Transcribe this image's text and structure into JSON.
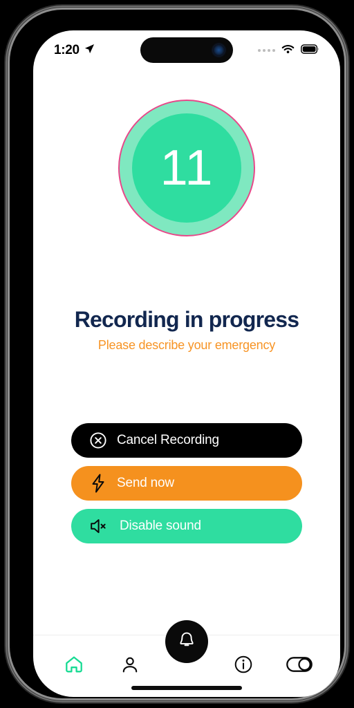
{
  "status_bar": {
    "time": "1:20",
    "location_icon": "location-arrow-icon",
    "signal_icon": "cellular-dots-icon",
    "wifi_icon": "wifi-icon",
    "battery_icon": "battery-full-icon"
  },
  "timer": {
    "count": "11",
    "ring_border_color": "#E8488A",
    "ring_fill_color": "#7FE8C0",
    "inner_fill_color": "#2FDDA0",
    "count_color": "#FFFFFF"
  },
  "headings": {
    "title": "Recording in progress",
    "title_color": "#12274F",
    "subtitle": "Please describe your emergency",
    "subtitle_color": "#F79425"
  },
  "actions": [
    {
      "label": "Cancel Recording",
      "icon": "circle-x-icon",
      "bg_color": "#000000",
      "text_color": "#FFFFFF"
    },
    {
      "label": "Send now",
      "icon": "lightning-bolt-icon",
      "bg_color": "#F5911E",
      "text_color": "#FFFFFF"
    },
    {
      "label": "Disable sound",
      "icon": "speaker-mute-icon",
      "bg_color": "#2FDDA0",
      "text_color": "#FFFFFF"
    }
  ],
  "bottom_nav": {
    "items": [
      {
        "name": "home",
        "icon": "home-icon",
        "active": true,
        "color": "#17DB93"
      },
      {
        "name": "profile",
        "icon": "person-icon",
        "active": false,
        "color": "#0A0A0A"
      },
      {
        "name": "alert",
        "icon": "bell-icon",
        "active": false,
        "color": "#FFFFFF"
      },
      {
        "name": "info",
        "icon": "info-circle-icon",
        "active": false,
        "color": "#0A0A0A"
      },
      {
        "name": "settings",
        "icon": "toggle-switch-icon",
        "active": false,
        "color": "#0A0A0A"
      }
    ],
    "fab_bg_color": "#0A0A0A"
  }
}
